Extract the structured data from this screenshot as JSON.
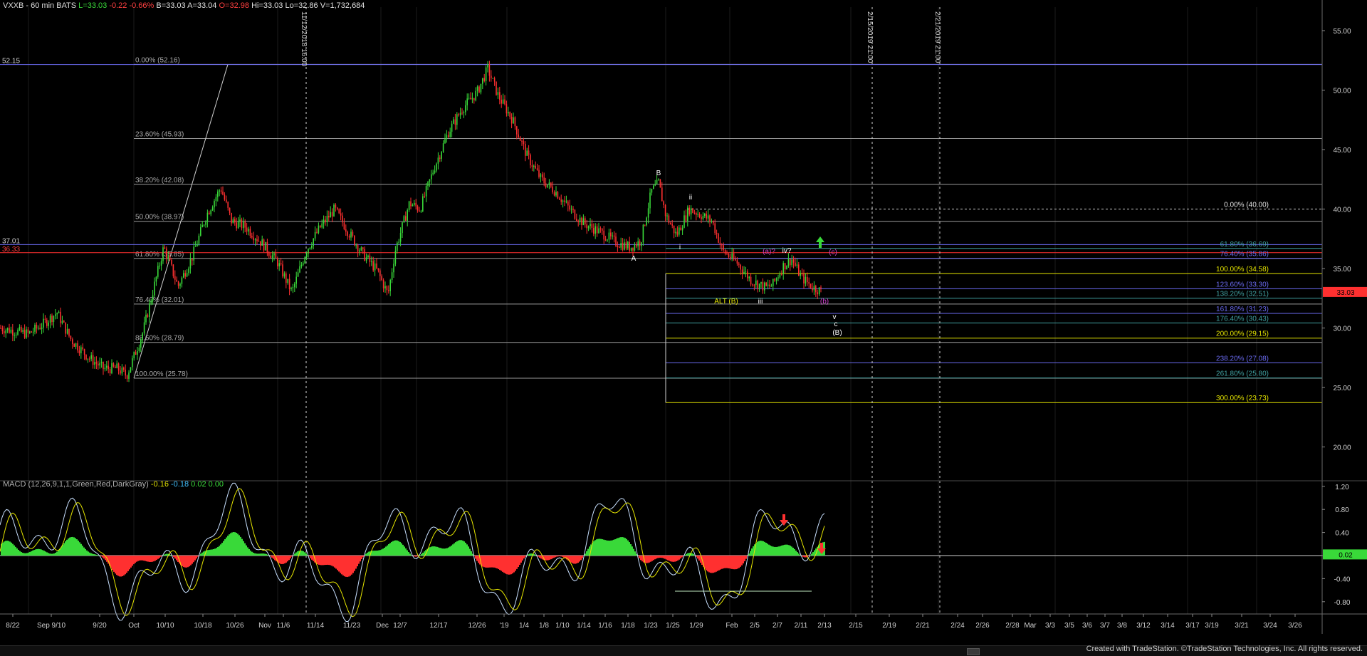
{
  "header": {
    "symbol": "VXXB - 60 min  BATS",
    "last": "L=33.03",
    "change": "-0.22",
    "pct": "-0.66%",
    "bid": "B=33.03",
    "ask": "A=33.04",
    "open": "O=32.98",
    "high": "Hi=33.03",
    "low": "Lo=32.86",
    "volume": "V=1,732,684"
  },
  "macd_header": {
    "label": "MACD (12,26,9,1,1,Green,Red,DarkGray)",
    "v1": "-0.16",
    "v2": "-0.18",
    "v3": "0.02",
    "v4": "0.00"
  },
  "footer": "Created with TradeStation. ©TradeStation Technologies, Inc. All rights reserved.",
  "colors": {
    "up": "#39d939",
    "down": "#ff3030",
    "fib_white": "#9a9a9a",
    "fib_yellow": "#e6e600",
    "fib_blue": "#6a6af0",
    "fib_teal": "#40a0a0",
    "magenta": "#d040d0",
    "macd_line": "#c8e0ff",
    "signal_line": "#e6e600"
  },
  "chart_data": [
    {
      "type": "candlestick",
      "ylim": [
        17.5,
        56.5
      ],
      "y_ticks": [
        "20.00",
        "25.00",
        "30.00",
        "35.00",
        "40.00",
        "45.00",
        "50.00",
        "55.00"
      ],
      "x_tick_labels": [
        "8/22",
        "Sep 9/10",
        "9/20",
        "Oct",
        "10/10",
        "10/18",
        "10/26",
        "Nov",
        "11/6",
        "11/14",
        "11/23",
        "Dec",
        "12/7",
        "12/17",
        "12/26",
        "'19",
        "1/4",
        "1/8",
        "1/10",
        "1/14",
        "1/16",
        "1/18",
        "1/23",
        "1/25",
        "1/29",
        "Feb",
        "2/5",
        "2/7",
        "2/11",
        "2/13",
        "2/15",
        "2/19",
        "2/21",
        "2/24",
        "2/26",
        "2/28",
        "Mar",
        "3/3",
        "3/5",
        "3/6",
        "3/7",
        "3/8",
        "3/12",
        "3/14",
        "3/17",
        "3/19",
        "3/21",
        "3/24",
        "3/26"
      ],
      "price_path": [
        [
          0,
          30.0
        ],
        [
          40,
          29.5
        ],
        [
          60,
          30.3
        ],
        [
          80,
          31.3
        ],
        [
          100,
          29.0
        ],
        [
          125,
          27.5
        ],
        [
          145,
          26.6
        ],
        [
          165,
          26.6
        ],
        [
          178,
          26.0
        ],
        [
          200,
          29.5
        ],
        [
          230,
          36.8
        ],
        [
          250,
          33.5
        ],
        [
          270,
          36.0
        ],
        [
          290,
          39.5
        ],
        [
          310,
          41.8
        ],
        [
          325,
          39.0
        ],
        [
          345,
          38.5
        ],
        [
          370,
          37.0
        ],
        [
          390,
          35.5
        ],
        [
          410,
          33.0
        ],
        [
          430,
          36.5
        ],
        [
          450,
          38.5
        ],
        [
          470,
          40.0
        ],
        [
          490,
          38.0
        ],
        [
          510,
          36.2
        ],
        [
          530,
          34.8
        ],
        [
          545,
          32.8
        ],
        [
          555,
          36.5
        ],
        [
          575,
          40.5
        ],
        [
          590,
          40.0
        ],
        [
          610,
          43.5
        ],
        [
          630,
          46.5
        ],
        [
          650,
          48.5
        ],
        [
          670,
          49.8
        ],
        [
          685,
          51.8
        ],
        [
          700,
          49.5
        ],
        [
          720,
          47.5
        ],
        [
          740,
          44.5
        ],
        [
          760,
          42.5
        ],
        [
          780,
          41.5
        ],
        [
          800,
          40.0
        ],
        [
          820,
          38.8
        ],
        [
          845,
          38.0
        ],
        [
          865,
          37.2
        ],
        [
          885,
          36.8
        ],
        [
          900,
          37.3
        ],
        [
          915,
          41.5
        ],
        [
          925,
          42.2
        ],
        [
          935,
          39.5
        ],
        [
          950,
          37.8
        ],
        [
          968,
          40.0
        ],
        [
          985,
          39.5
        ],
        [
          1000,
          39.0
        ],
        [
          1015,
          36.5
        ],
        [
          1035,
          35.5
        ],
        [
          1055,
          34.0
        ],
        [
          1075,
          33.4
        ],
        [
          1085,
          33.6
        ],
        [
          1100,
          35.2
        ],
        [
          1112,
          35.8
        ],
        [
          1125,
          34.3
        ],
        [
          1140,
          33.5
        ],
        [
          1155,
          33.03
        ]
      ],
      "price_line": {
        "price": "33.03",
        "color": "#ff3030"
      },
      "fib_levels_left": [
        {
          "label": "0.00% (52.16)",
          "value": 52.16,
          "color": "#9a9a9a"
        },
        {
          "label": "23.60% (45.93)",
          "value": 45.93,
          "color": "#9a9a9a"
        },
        {
          "label": "38.20% (42.08)",
          "value": 42.08,
          "color": "#9a9a9a"
        },
        {
          "label": "50.00% (38.97)",
          "value": 38.97,
          "color": "#9a9a9a"
        },
        {
          "label": "61.80% (35.85)",
          "value": 35.85,
          "color": "#9a9a9a"
        },
        {
          "label": "76.40% (32.01)",
          "value": 32.01,
          "color": "#9a9a9a"
        },
        {
          "label": "88.60% (28.79)",
          "value": 28.79,
          "color": "#9a9a9a"
        },
        {
          "label": "100.00% (25.78)",
          "value": 25.78,
          "color": "#9a9a9a"
        }
      ],
      "fib_levels_right": [
        {
          "label": "0.00% (40.00)",
          "value": 40.0,
          "color": "#d0d0d0",
          "dashed": true
        },
        {
          "label": "61.80% (36.69)",
          "value": 36.69,
          "color": "#40a0a0"
        },
        {
          "label": "76.40% (35.86)",
          "value": 35.86,
          "color": "#6a6af0"
        },
        {
          "label": "100.00% (34.58)",
          "value": 34.58,
          "color": "#e6e600"
        },
        {
          "label": "123.60% (33.30)",
          "value": 33.3,
          "color": "#6a6af0"
        },
        {
          "label": "138.20% (32.51)",
          "value": 32.51,
          "color": "#40a0a0"
        },
        {
          "label": "161.80% (31.23)",
          "value": 31.23,
          "color": "#6a6af0"
        },
        {
          "label": "176.40% (30.43)",
          "value": 30.43,
          "color": "#40a0a0"
        },
        {
          "label": "200.00% (29.15)",
          "value": 29.15,
          "color": "#e6e600"
        },
        {
          "label": "238.20% (27.08)",
          "value": 27.08,
          "color": "#6a6af0"
        },
        {
          "label": "261.80% (25.80)",
          "value": 25.8,
          "color": "#40a0a0"
        },
        {
          "label": "300.00% (23.73)",
          "value": 23.73,
          "color": "#e6e600"
        }
      ],
      "horizontal_lines": [
        {
          "label": "52.15",
          "value": 52.15,
          "color": "#6a6af0"
        },
        {
          "label": "37.01",
          "value": 37.01,
          "color": "#6a6af0"
        },
        {
          "label": "36.33",
          "value": 36.33,
          "color": "#ff3030"
        }
      ],
      "vertical_markers": [
        "11/12/2018 16:00",
        "2/15/2019 21:00",
        "2/21/2019 21:00"
      ],
      "wave_labels": [
        {
          "text": "B",
          "color": "#ffffff"
        },
        {
          "text": "A",
          "color": "#ffffff"
        },
        {
          "text": "ii",
          "color": "#ffffff"
        },
        {
          "text": "i",
          "color": "#ffffff"
        },
        {
          "text": "(a)?",
          "color": "#d040d0"
        },
        {
          "text": "iv?",
          "color": "#ffffff"
        },
        {
          "text": "(c)",
          "color": "#d040d0"
        },
        {
          "text": "ALT (B)",
          "color": "#e6e600"
        },
        {
          "text": "iii",
          "color": "#ffffff"
        },
        {
          "text": "(b)",
          "color": "#d040d0"
        },
        {
          "text": "v",
          "color": "#ffffff"
        },
        {
          "text": "c",
          "color": "#ffffff"
        },
        {
          "text": "(B)",
          "color": "#ffffff"
        }
      ]
    },
    {
      "type": "macd",
      "ylim": [
        -1.25,
        1.25
      ],
      "y_ticks": [
        "1.20",
        "0.80",
        "0.40",
        "0.00",
        "-0.40",
        "-0.80"
      ],
      "current_value": "0.02",
      "histogram_positive_color": "#39d939",
      "histogram_negative_color": "#ff3030"
    }
  ]
}
